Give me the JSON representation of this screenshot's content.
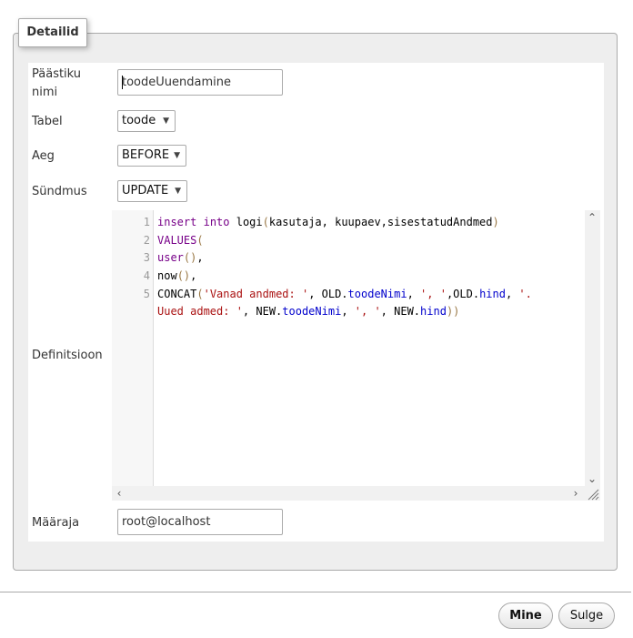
{
  "legend": "Detailid",
  "fields": {
    "name_label": "Päästiku nimi",
    "name_value": "toodeUuendamine",
    "table_label": "Tabel",
    "table_value": "toode",
    "time_label": "Aeg",
    "time_value": "BEFORE",
    "event_label": "Sündmus",
    "event_value": "UPDATE",
    "definition_label": "Definitsioon",
    "definer_label": "Määraja",
    "definer_value": "root@localhost"
  },
  "code": {
    "line_numbers": [
      "1",
      "2",
      "3",
      "4",
      "5"
    ],
    "l1": {
      "kw1": "insert",
      "kw2": "into",
      "fn": " logi",
      "p1": "(",
      "args": "kasutaja, kuupaev,sisestatudAndmed",
      "p2": ")"
    },
    "l2": {
      "kw": "VALUES",
      "p": "("
    },
    "l3": {
      "fn": "user",
      "p": "()",
      "tail": ","
    },
    "l4": {
      "fn": "now",
      "p": "()",
      "tail": ","
    },
    "l5": {
      "fn": "CONCAT",
      "p1": "(",
      "s1": "'Vanad andmed: '",
      "c1": ", OLD.",
      "prop1": "toodeNimi",
      "c2": ", ",
      "s2": "', '",
      "c3": ",OLD.",
      "prop2": "hind",
      "c4": ", ",
      "s3": "'."
    },
    "l6": {
      "s1": "Uued admed: '",
      "c1": ", NEW.",
      "prop1": "toodeNimi",
      "c2": ", ",
      "s2": "', '",
      "c3": ", NEW.",
      "prop2": "hind",
      "p": "))"
    }
  },
  "buttons": {
    "go": "Mine",
    "close": "Sulge"
  },
  "icons": {
    "scroll_up": "chevron-up-icon",
    "scroll_down": "chevron-down-icon",
    "scroll_left": "chevron-left-icon",
    "scroll_right": "chevron-right-icon",
    "resize": "resize-grip-icon"
  }
}
